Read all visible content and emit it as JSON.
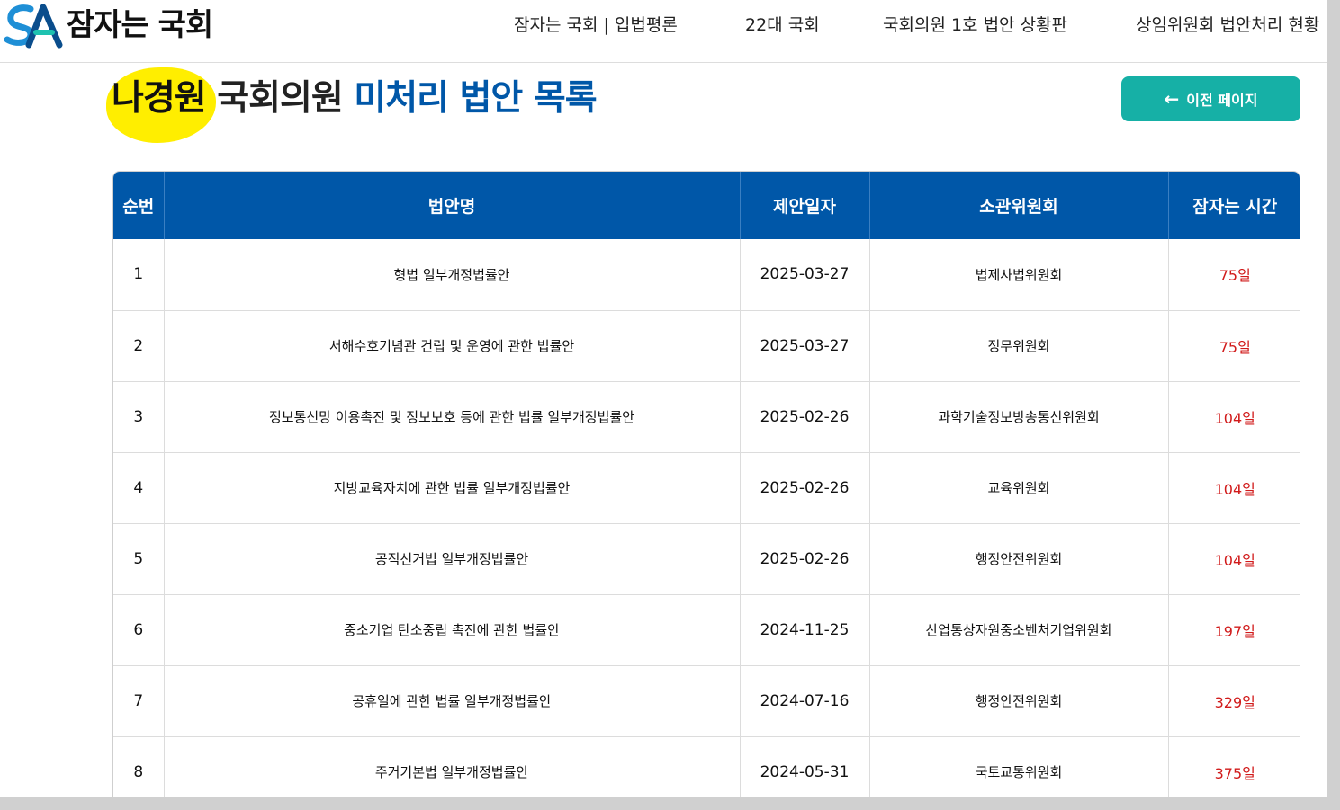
{
  "header": {
    "logo_text": "잠자는 국회",
    "nav": [
      {
        "label": "잠자는 국회 | 입법평론"
      },
      {
        "label": "22대 국회"
      },
      {
        "label": "국회의원 1호 법안 상황판"
      },
      {
        "label": "상임위원회 법안처리 현황"
      }
    ]
  },
  "title": {
    "highlight": "나경원",
    "middle": "국회의원",
    "accent": "미처리 법안 목록"
  },
  "back_button": {
    "label": "이전 페이지",
    "icon": "arrow-left-icon"
  },
  "table": {
    "columns": [
      "순번",
      "법안명",
      "제안일자",
      "소관위원회",
      "잠자는 시간"
    ],
    "rows": [
      {
        "no": "1",
        "name": "형법 일부개정법률안",
        "date": "2025-03-27",
        "committee": "법제사법위원회",
        "time": "75일"
      },
      {
        "no": "2",
        "name": "서해수호기념관 건립 및 운영에 관한 법률안",
        "date": "2025-03-27",
        "committee": "정무위원회",
        "time": "75일"
      },
      {
        "no": "3",
        "name": "정보통신망 이용촉진 및 정보보호 등에 관한 법률 일부개정법률안",
        "date": "2025-02-26",
        "committee": "과학기술정보방송통신위원회",
        "time": "104일"
      },
      {
        "no": "4",
        "name": "지방교육자치에 관한 법률 일부개정법률안",
        "date": "2025-02-26",
        "committee": "교육위원회",
        "time": "104일"
      },
      {
        "no": "5",
        "name": "공직선거법 일부개정법률안",
        "date": "2025-02-26",
        "committee": "행정안전위원회",
        "time": "104일"
      },
      {
        "no": "6",
        "name": "중소기업 탄소중립 촉진에 관한 법률안",
        "date": "2024-11-25",
        "committee": "산업통상자원중소벤처기업위원회",
        "time": "197일"
      },
      {
        "no": "7",
        "name": "공휴일에 관한 법률 일부개정법률안",
        "date": "2024-07-16",
        "committee": "행정안전위원회",
        "time": "329일"
      },
      {
        "no": "8",
        "name": "주거기본법 일부개정법률안",
        "date": "2024-05-31",
        "committee": "국토교통위원회",
        "time": "375일"
      }
    ]
  },
  "colors": {
    "header_blue": "#0057a8",
    "accent_teal": "#16b0a6",
    "highlight_yellow": "#ffee00",
    "time_red": "#d11a1a"
  }
}
